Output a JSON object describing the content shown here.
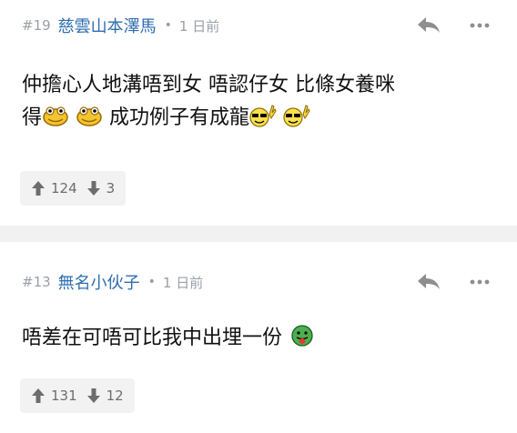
{
  "comments": [
    {
      "number": "#19",
      "username": "慈雲山本澤馬",
      "separator": "•",
      "time": "1 日前",
      "line1": "仲擔心人地溝唔到女 唔認仔女 比條女養咪",
      "line2_prefix": "得",
      "line2_text": "成功例子有成龍",
      "upvotes": "124",
      "downvotes": "3",
      "icons": [
        "reply-arrow-icon",
        "more-dots-icon",
        "frog-emoji",
        "sunglasses-rock-emoji",
        "thumb-up-icon",
        "thumb-down-icon"
      ]
    },
    {
      "number": "#13",
      "username": "無名小伙子",
      "separator": "•",
      "time": "1 日前",
      "line1": "唔差在可唔可比我中出埋一份",
      "upvotes": "131",
      "downvotes": "12",
      "icons": [
        "reply-arrow-icon",
        "more-dots-icon",
        "tongue-emoji",
        "thumb-up-icon",
        "thumb-down-icon"
      ]
    }
  ],
  "colors": {
    "username": "#2f6eb0",
    "meta": "#9aa0a6",
    "text": "#111111",
    "separator": "#f1f1f1",
    "vote_bg": "#f2f2f2"
  }
}
